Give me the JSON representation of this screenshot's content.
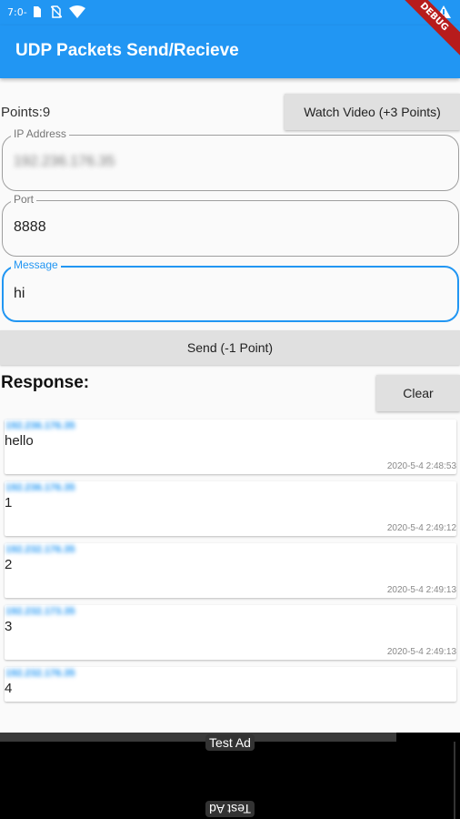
{
  "status_bar": {
    "time": "7:0-",
    "icons": [
      "sim-icon",
      "no-sim-icon",
      "wifi-icon",
      "warning-icon"
    ]
  },
  "app_bar": {
    "title": "UDP Packets Send/Recieve",
    "debug_ribbon": "DEBUG"
  },
  "points": {
    "label": "Points:9"
  },
  "buttons": {
    "watch_video": "Watch Video (+3 Points)",
    "send": "Send (-1 Point)",
    "clear": "Clear"
  },
  "fields": {
    "ip": {
      "label": "IP Address",
      "value": "192.236.176.35"
    },
    "port": {
      "label": "Port",
      "value": "8888"
    },
    "message": {
      "label": "Message",
      "value": "hi"
    }
  },
  "response": {
    "title": "Response:",
    "items": [
      {
        "sender": "192.236.176.35",
        "message": "hello",
        "timestamp": "2020-5-4 2:48:53"
      },
      {
        "sender": "192.236.176.35",
        "message": "1",
        "timestamp": "2020-5-4 2:49:12"
      },
      {
        "sender": "192.232.176.35",
        "message": "2",
        "timestamp": "2020-5-4 2:49:13"
      },
      {
        "sender": "192.232.173.35",
        "message": "3",
        "timestamp": "2020-5-4 2:49:13"
      },
      {
        "sender": "192.232.176.35",
        "message": "4",
        "timestamp": ""
      }
    ]
  },
  "ad": {
    "label": "Test Ad"
  },
  "colors": {
    "primary": "#2196f3",
    "button_bg": "#e0e0e0",
    "ad_bg": "#000000"
  }
}
